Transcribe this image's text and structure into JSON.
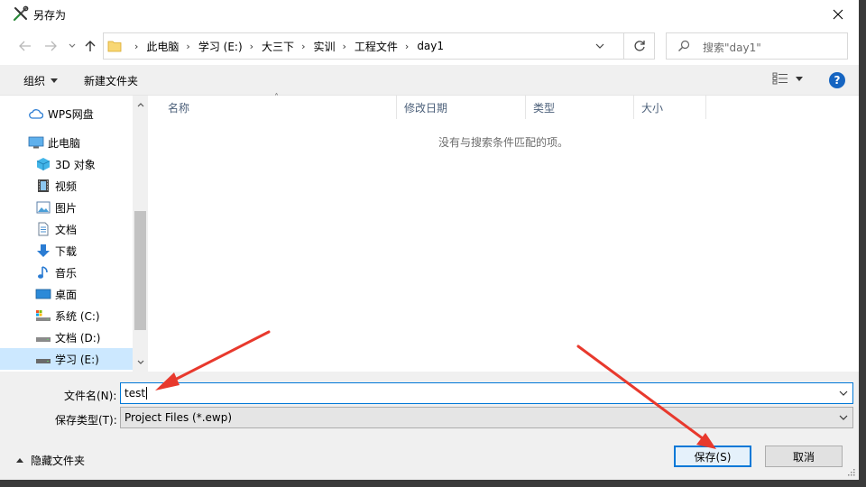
{
  "window": {
    "title": "另存为"
  },
  "breadcrumb": [
    "此电脑",
    "学习 (E:)",
    "大三下",
    "实训",
    "工程文件",
    "day1"
  ],
  "search": {
    "placeholder": "搜索\"day1\""
  },
  "toolbar": {
    "organize_label": "组织",
    "new_folder_label": "新建文件夹",
    "help_label": "?"
  },
  "nav": {
    "items": [
      {
        "label": "WPS网盘",
        "icon": "cloud-icon"
      },
      {
        "label": "此电脑",
        "icon": "computer-icon"
      },
      {
        "label": "3D 对象",
        "icon": "3d-objects-icon"
      },
      {
        "label": "视频",
        "icon": "video-icon"
      },
      {
        "label": "图片",
        "icon": "picture-icon"
      },
      {
        "label": "文档",
        "icon": "document-icon"
      },
      {
        "label": "下载",
        "icon": "download-icon"
      },
      {
        "label": "音乐",
        "icon": "music-icon"
      },
      {
        "label": "桌面",
        "icon": "desktop-icon"
      },
      {
        "label": "系统 (C:)",
        "icon": "drive-icon"
      },
      {
        "label": "文档 (D:)",
        "icon": "drive-icon"
      },
      {
        "label": "学习 (E:)",
        "icon": "drive-icon",
        "selected": true
      }
    ]
  },
  "columns": [
    "名称",
    "修改日期",
    "类型",
    "大小"
  ],
  "empty_message": "没有与搜索条件匹配的项。",
  "form": {
    "filename_label": "文件名(N):",
    "filename_value": "test",
    "filetype_label": "保存类型(T):",
    "filetype_value": "Project Files (*.ewp)"
  },
  "footer": {
    "hide_folders_label": "隐藏文件夹",
    "save_label": "保存(S)",
    "cancel_label": "取消"
  },
  "colors": {
    "accent": "#0078d7",
    "selection": "#cce8ff",
    "annotation_arrow": "#e8392d"
  }
}
